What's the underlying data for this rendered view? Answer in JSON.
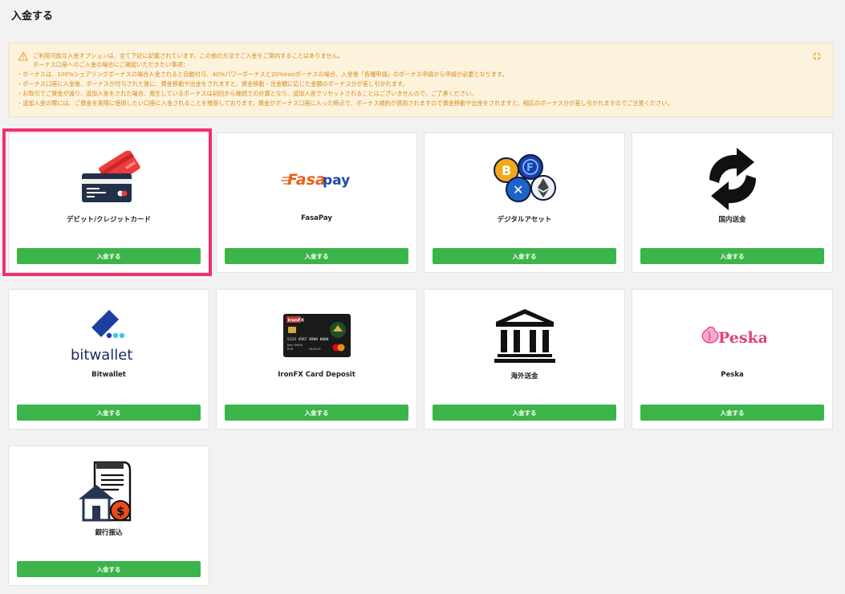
{
  "page": {
    "title": "入金する"
  },
  "notice": {
    "lines": [
      "ご利用可能な入金オプションは、全て下記に記載されています。この他の方法でご入金をご案内することはありません。",
      "ボーナス口座へのご入金の場合にご確認いただきたい事項：",
      "・ボーナスは、100%シェアリングボーナスの場合入金されると自動付与、40%パワーボーナスと20%Ironボーナスの場合、入金後「各種申請」のボーナス申請から申請が必要となります。",
      "・ボーナス口座に入金後、ボーナスが付与された後に、資金移動や出金をされますと、資金移動・出金額に応じた金額のボーナス分が差し引かれます。",
      "・お取引でご資金が減り、追加入金をされた場合、発生しているボーナスは初回から継続での計算となり、追加入金でリセットされることはございませんので、ご了承ください。",
      "・追加入金の際には、ご資金を実際に使用したい口座に入金されることを推奨しております。資金がボーナス口座に入った時点で、ボーナス規約が適用されますので資金移動や出金をされますと、相応のボーナス分が差し引かれますのでご注意ください。"
    ]
  },
  "methods": [
    {
      "name": "デビット/クレジットカード",
      "button": "入金する",
      "icon": "credit-card-icon"
    },
    {
      "name": "FasaPay",
      "button": "入金する",
      "icon": "fasapay-logo",
      "logo_text": "Fasapay"
    },
    {
      "name": "デジタルアセット",
      "button": "入金する",
      "icon": "crypto-coins-icon"
    },
    {
      "name": "国内送金",
      "button": "入金する",
      "icon": "domestic-transfer-icon"
    },
    {
      "name": "Bitwallet",
      "button": "入金する",
      "icon": "bitwallet-logo",
      "logo_text": "bitwallet"
    },
    {
      "name": "IronFX Card Deposit",
      "button": "入金する",
      "icon": "ironfx-card-icon",
      "card_brand": "IronFX",
      "card_number": "5123 4567 8900 0000",
      "card_holder": "John Smith",
      "card_currency": "EUR",
      "card_expiry": "05/2015"
    },
    {
      "name": "海外送金",
      "button": "入金する",
      "icon": "bank-icon"
    },
    {
      "name": "Peska",
      "button": "入金する",
      "icon": "peska-logo",
      "logo_text": "Peska"
    },
    {
      "name": "銀行振込",
      "button": "入金する",
      "icon": "bank-transfer-icon"
    }
  ],
  "colors": {
    "button": "#3bb54a",
    "highlight": "#f0306e",
    "notice_text": "#d58a1c",
    "notice_bg": "#fdf3dc"
  }
}
